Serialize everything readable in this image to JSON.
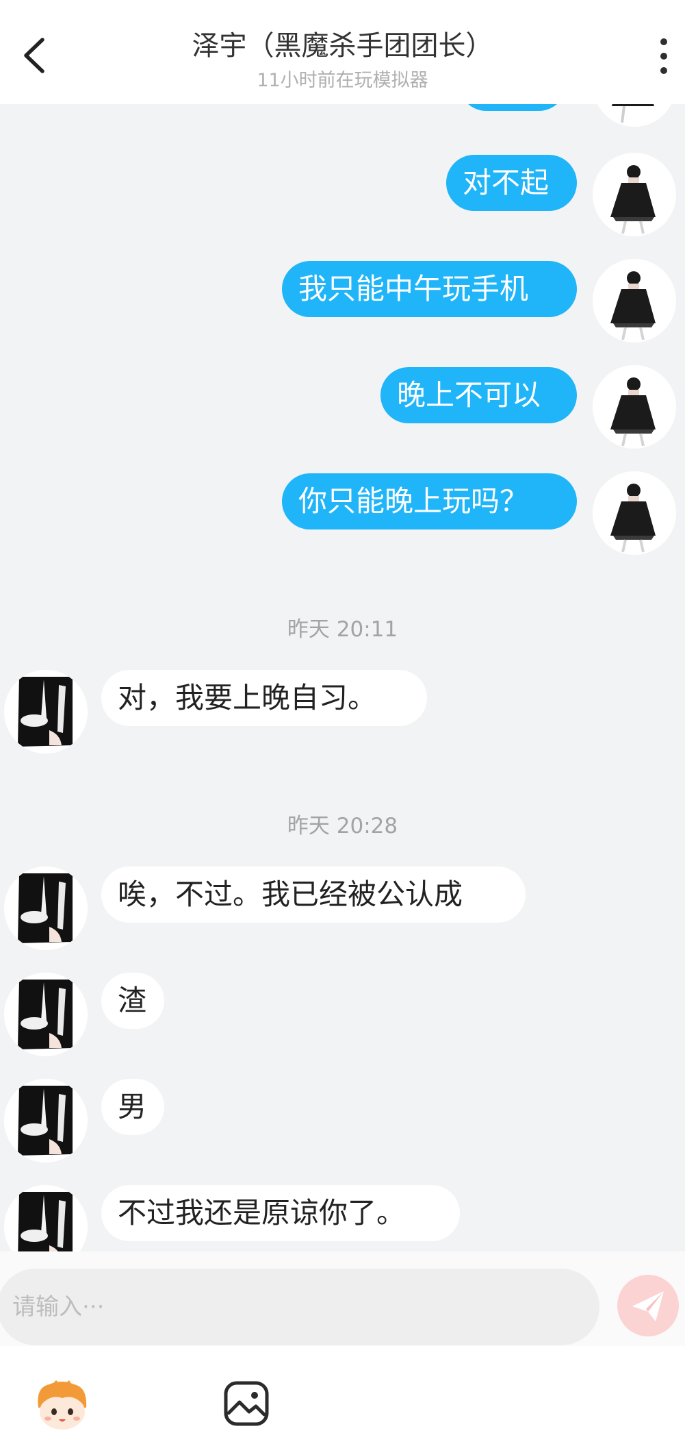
{
  "header": {
    "title": "泽宇（黑魔杀手团团长）",
    "subtitle": "11小时前在玩模拟器",
    "back_icon": "chevron-left-icon",
    "more_icon": "more-vertical-icon"
  },
  "colors": {
    "sent_bubble": "#1fb5f8",
    "received_bubble": "#ffffff",
    "background": "#f2f3f5",
    "send_button": "#fcd3d3"
  },
  "messages": {
    "sent": [
      "对不起",
      "我只能中午玩手机",
      "晚上不可以",
      "你只能晚上玩吗？"
    ],
    "ts1": "昨天 20:11",
    "r1": "对，我要上晚自习。",
    "ts2": "昨天 20:28",
    "r2": "唉，不过。我已经被公认成",
    "r3": "渣",
    "r4": "男",
    "r5": "不过我还是原谅你了。"
  },
  "composer": {
    "placeholder": "请输入···",
    "send_icon": "paper-plane-icon"
  },
  "toolbar": {
    "emoji_icon": "mascot-emoji-icon",
    "image_icon": "image-icon"
  }
}
